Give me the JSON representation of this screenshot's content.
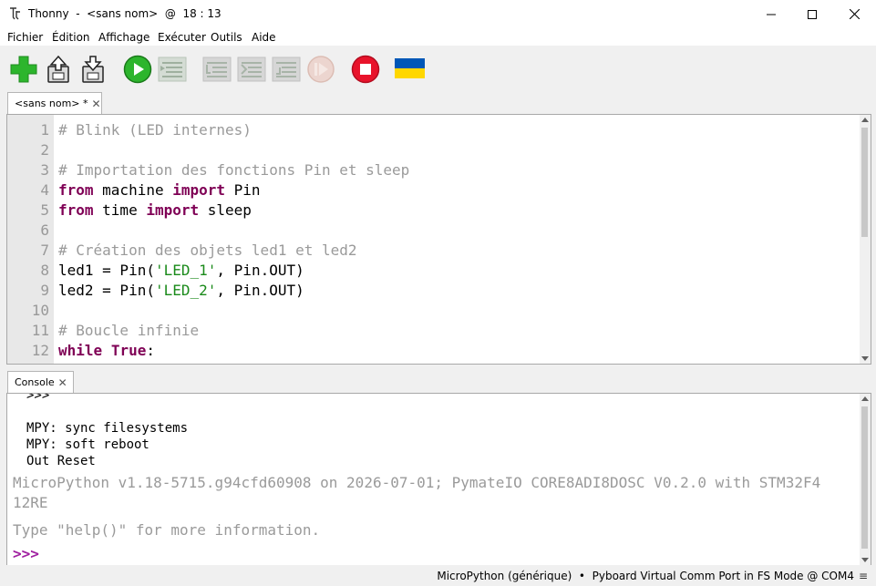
{
  "window": {
    "title": "Thonny  -  <sans nom>  @  18 : 13"
  },
  "menubar": {
    "items": [
      "Fichier",
      "Édition",
      "Affichage",
      "Exécuter",
      "Outils",
      "Aide"
    ]
  },
  "toolbar": {
    "buttons": [
      {
        "icon": "new-file-icon",
        "enabled": true
      },
      {
        "icon": "open-file-icon",
        "enabled": true
      },
      {
        "icon": "save-file-icon",
        "enabled": true
      },
      {
        "icon": "run-icon",
        "enabled": true
      },
      {
        "icon": "debug-icon",
        "enabled": false
      },
      {
        "icon": "step-over-icon",
        "enabled": false
      },
      {
        "icon": "step-into-icon",
        "enabled": false
      },
      {
        "icon": "step-out-icon",
        "enabled": false
      },
      {
        "icon": "resume-icon",
        "enabled": false
      },
      {
        "icon": "stop-icon",
        "enabled": true
      },
      {
        "icon": "ukraine-flag-icon",
        "enabled": true
      }
    ],
    "colors": {
      "green": "#2db52d",
      "stop_red": "#e8132b",
      "flag_blue": "#0057b7",
      "flag_yellow": "#ffd700"
    }
  },
  "editor": {
    "tab_label": "<sans nom> *",
    "line_numbers": [
      "1",
      "2",
      "3",
      "4",
      "5",
      "6",
      "7",
      "8",
      "9",
      "10",
      "11",
      "12"
    ],
    "lines": [
      {
        "c": "# Blink (LED internes)"
      },
      {},
      {
        "c": "# Importation des fonctions Pin et sleep"
      },
      {
        "k1": "from",
        "t1": " machine ",
        "k2": "import",
        "t2": " Pin"
      },
      {
        "k1": "from",
        "t1": " time ",
        "k2": "import",
        "t2": " sleep"
      },
      {},
      {
        "c": "# Création des objets led1 et led2"
      },
      {
        "t1": "led1 = Pin(",
        "s": "'LED_1'",
        "t2": ", Pin.OUT)"
      },
      {
        "t1": "led2 = Pin(",
        "s": "'LED_2'",
        "t2": ", Pin.OUT)"
      },
      {},
      {
        "c": "# Boucle infinie"
      },
      {
        "k1": "while",
        "t1": " ",
        "k2": "True",
        "t2": ":"
      }
    ]
  },
  "console": {
    "tab_label": "Console",
    "lines": [
      ">>>",
      "",
      "MPY: sync filesystems",
      "MPY: soft reboot",
      "Out Reset"
    ],
    "banner": [
      "MicroPython v1.18-5715.g94cfd60908 on 2026-07-01; PymateIO CORE8ADI8DOSC V0.2.0 with STM32F4",
      "12RE"
    ],
    "help_line": "Type \"help()\" for more information.",
    "prompt": ">>>"
  },
  "statusbar": {
    "text": "MicroPython (générique)  •  Pyboard Virtual Comm Port in FS Mode @ COM4",
    "menu_glyph": "≡"
  }
}
